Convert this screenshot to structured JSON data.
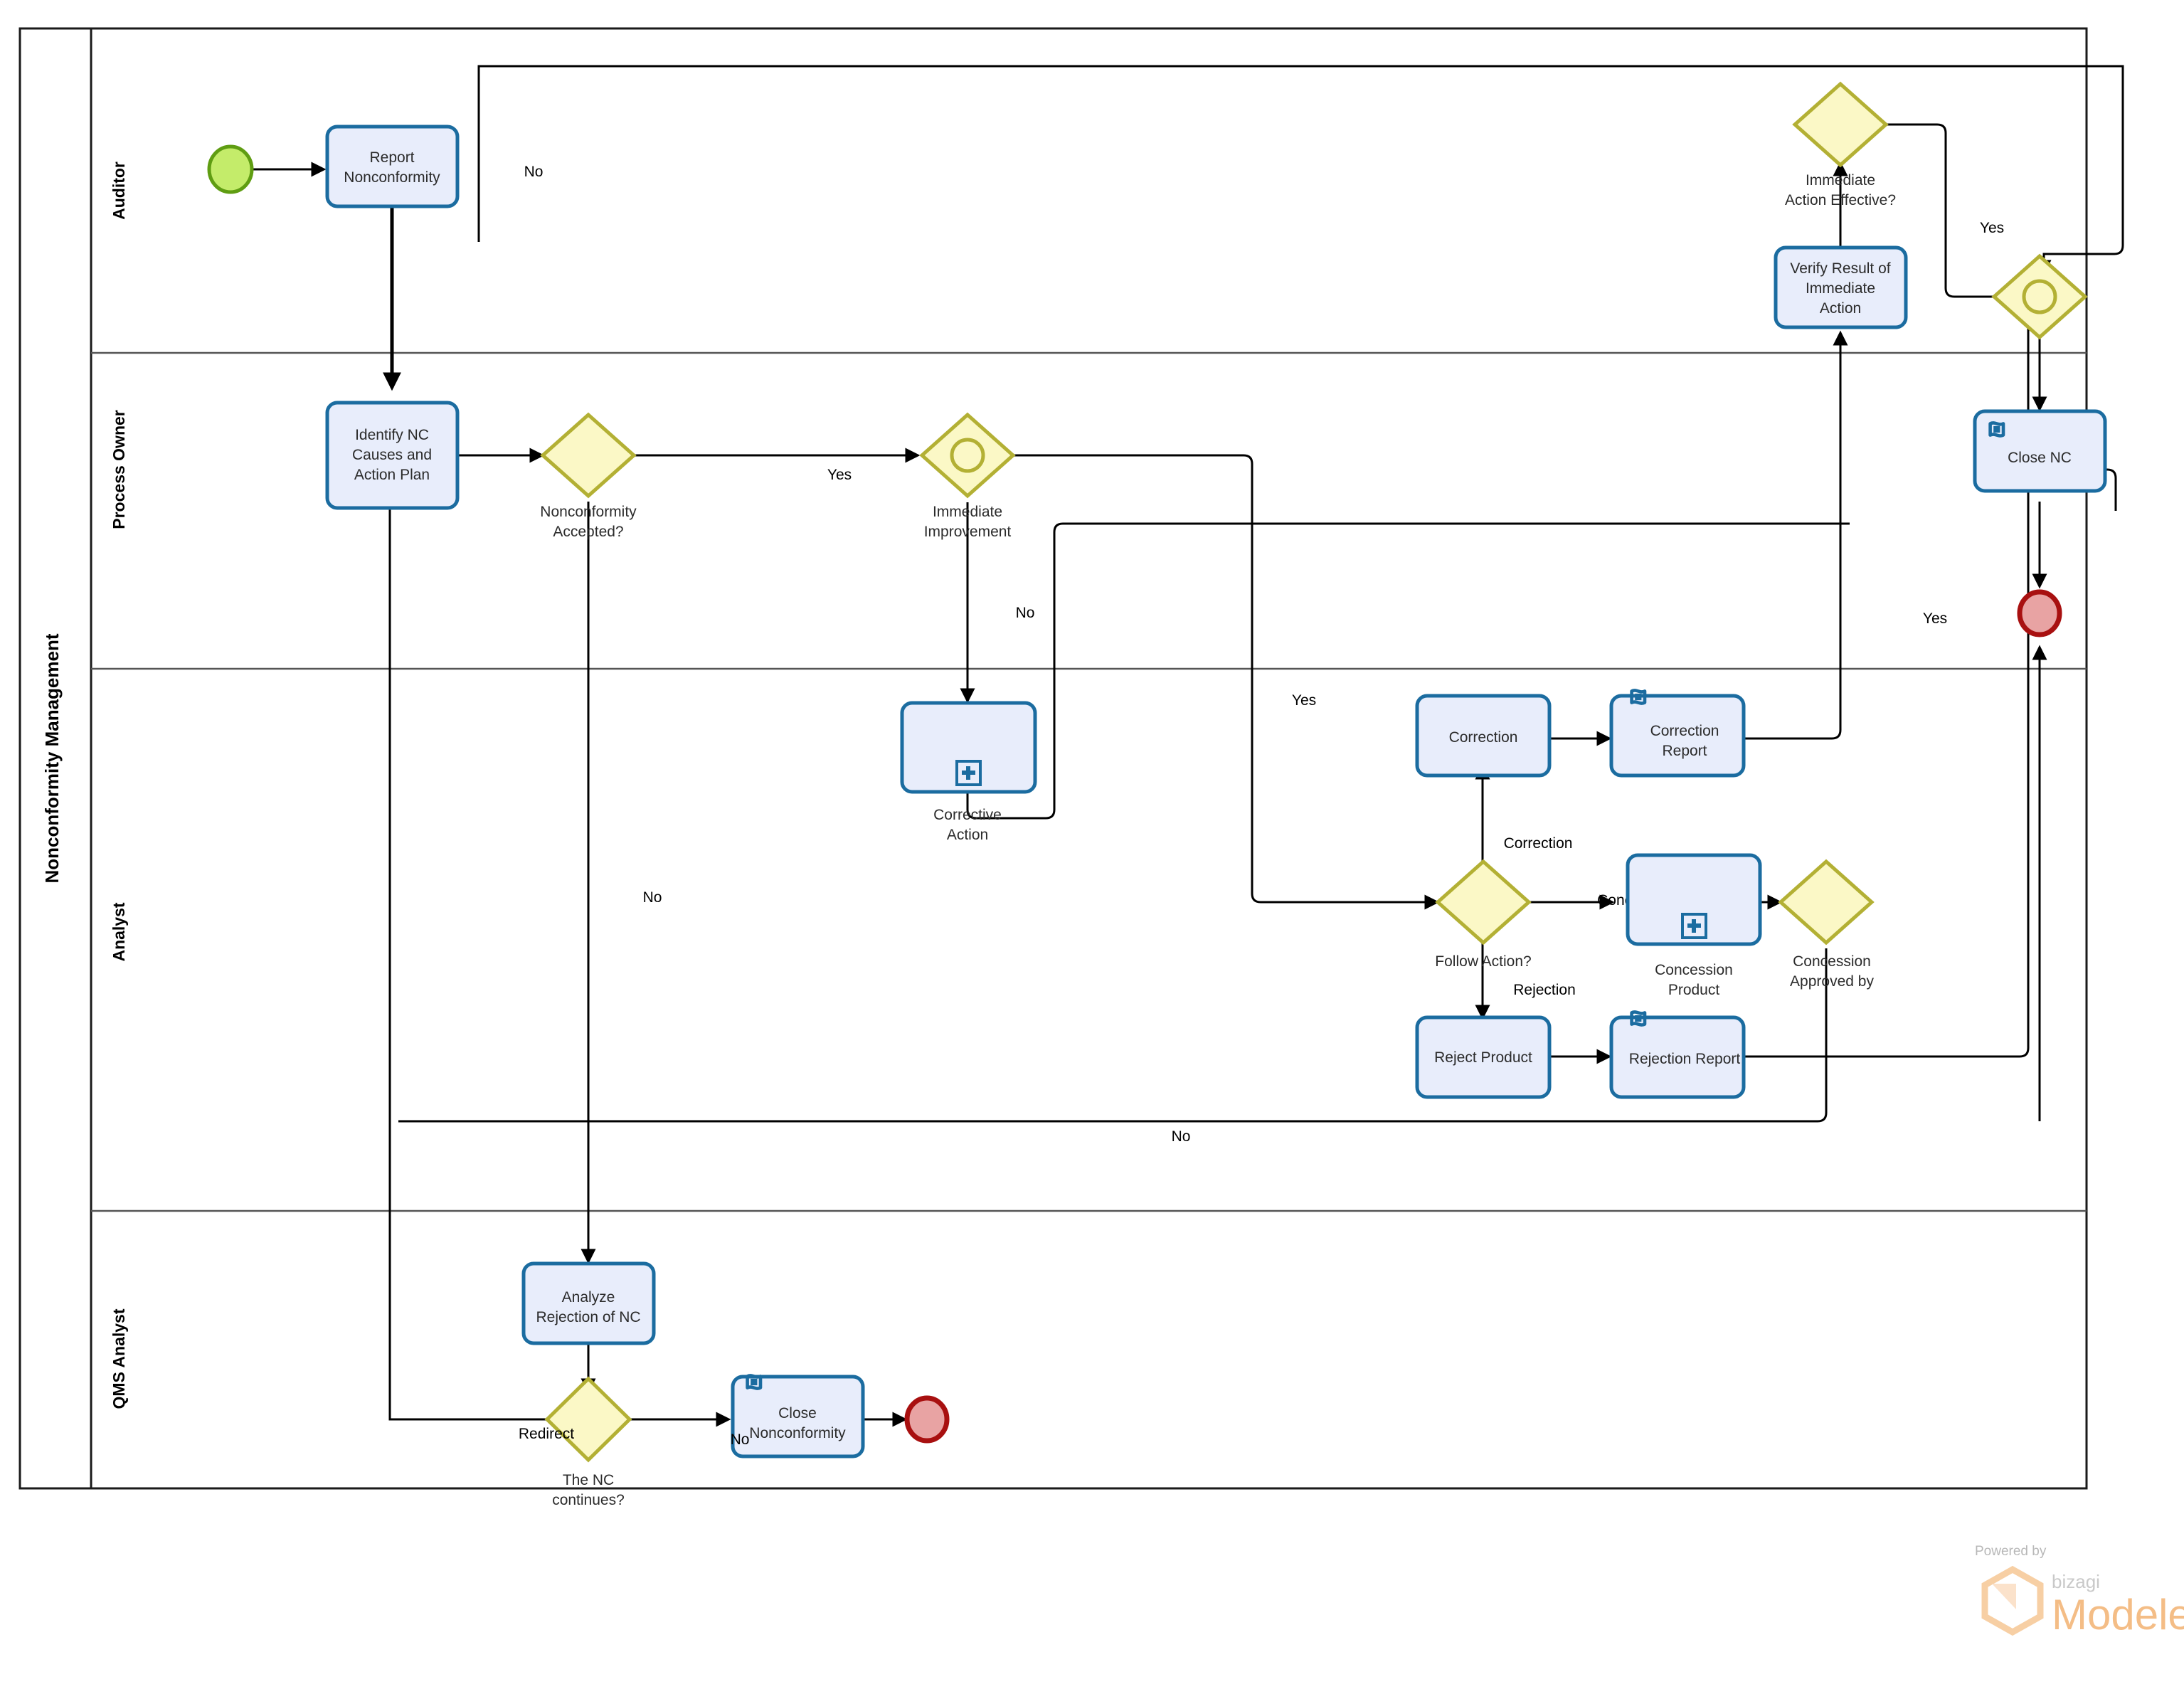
{
  "pool": {
    "title": "Nonconformity Management"
  },
  "lanes": [
    {
      "id": "auditor",
      "label": "Auditor"
    },
    {
      "id": "process_owner",
      "label": "Process Owner"
    },
    {
      "id": "analyst",
      "label": "Analyst"
    },
    {
      "id": "qms_analyst",
      "label": "QMS Analyst"
    }
  ],
  "tasks": {
    "report_nonconformity": "Report Nonconformity",
    "report_nonconformity_l1": "Report",
    "report_nonconformity_l2": "Nonconformity",
    "verify_result_l1": "Verify Result of",
    "verify_result_l2": "Immediate",
    "verify_result_l3": "Action",
    "identify_nc_l1": "Identify NC",
    "identify_nc_l2": "Causes and",
    "identify_nc_l3": "Action Plan",
    "close_nc": "Close NC",
    "corrective_action_l1": "Corrective",
    "corrective_action_l2": "Action",
    "correction": "Correction",
    "correction_report_l1": "Correction",
    "correction_report_l2": "Report",
    "concession_product_l1": "Concession",
    "concession_product_l2": "Product",
    "reject_product": "Reject Product",
    "rejection_report": "Rejection Report",
    "analyze_rejection_l1": "Analyze",
    "analyze_rejection_l2": "Rejection of NC",
    "close_nonconformity_l1": "Close",
    "close_nonconformity_l2": "Nonconformity"
  },
  "gateways": {
    "immediate_action_effective_l1": "Immediate",
    "immediate_action_effective_l2": "Action Effective?",
    "nonconformity_accepted_l1": "Nonconformity",
    "nonconformity_accepted_l2": "Accepted?",
    "immediate_improvement_l1": "Immediate",
    "immediate_improvement_l2": "Improvement",
    "follow_action": "Follow Action?",
    "concession_approved_l1": "Concession",
    "concession_approved_l2": "Approved by",
    "the_nc_continues_l1": "The NC",
    "the_nc_continues_l2": "continues?"
  },
  "flow_labels": {
    "no_auditor": "No",
    "yes_nc_accepted": "Yes",
    "no_immediate_improvement": "No",
    "no_nonconformity_accepted": "No",
    "yes_immediate_action_effective": "Yes",
    "yes_end": "Yes",
    "yes_follow_action": "Yes",
    "correction": "Correction",
    "concession": "Concession",
    "rejection": "Rejection",
    "no_analyst_bottom": "No",
    "redirect": "Redirect",
    "no_nc_continues": "No"
  },
  "branding": {
    "powered_by": "Powered by",
    "bizagi": "bizagi",
    "modeler": "Modeler"
  },
  "colors": {
    "task_fill": "#e8edfb",
    "task_stroke": "#1b6ca0",
    "gateway_fill": "#fbf8c6",
    "gateway_stroke": "#b3b034",
    "start_fill": "#c4ec6a",
    "start_stroke": "#5f9d12",
    "end_fill": "#e8a3a3",
    "end_stroke": "#a81010",
    "brand_orange": "#f4bd86"
  }
}
